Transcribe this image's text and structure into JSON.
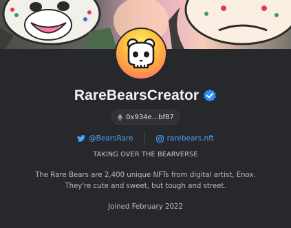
{
  "profile": {
    "name": "RareBearsCreator",
    "wallet_address": "0x934e...bf87",
    "twitter_handle": "@BearsRare",
    "website": "rarebears.nft",
    "tagline": "TAKING OVER THE BEARVERSE",
    "description_line1": "The Rare Bears are 2,400 unique NFTs from digital artist, Enox.",
    "description_line2": "They're cute and sweet, but tough and street.",
    "joined": "Joined February 2022"
  },
  "icons": {
    "verified": "verified-badge-icon",
    "wallet": "ethereum-icon",
    "twitter": "twitter-icon",
    "website": "instagram-icon"
  },
  "colors": {
    "background": "#26282b",
    "link": "#4aa3ff",
    "verified": "#2e8fff",
    "title": "#f2f2f2"
  }
}
